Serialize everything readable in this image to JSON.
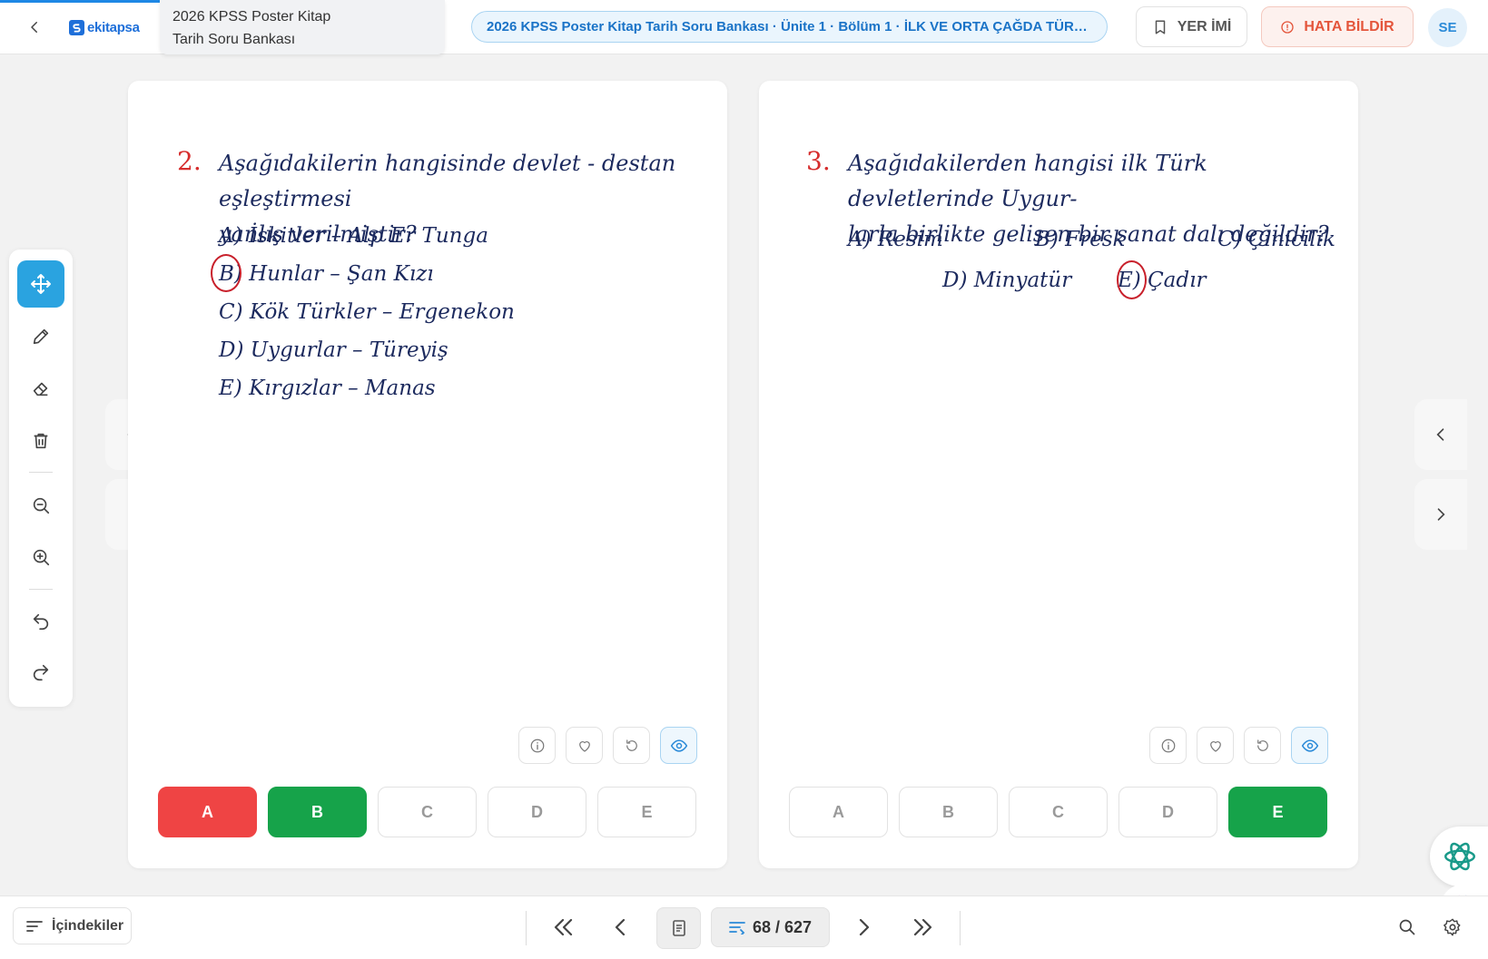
{
  "header": {
    "logo_text": "ekitapsa",
    "book_title_line1": "2026 KPSS Poster Kitap",
    "book_title_line2": "Tarih Soru Bankası",
    "breadcrumb": "2026 KPSS Poster Kitap Tarih Soru Bankası · Ünite 1 · Bölüm 1 · İLK VE ORTA ÇAĞDA TÜRK ...",
    "bookmark_label": "YER İMİ",
    "report_label": "HATA BİLDİR",
    "avatar_initials": "SE"
  },
  "toolbar": {
    "tools": [
      "move-icon",
      "pencil-icon",
      "eraser-icon",
      "trash-icon",
      "zoom-out-icon",
      "zoom-in-icon",
      "undo-icon",
      "redo-icon"
    ],
    "active_tool": "move-icon"
  },
  "left_page": {
    "question_number": "2.",
    "question_line1": "Aşağıdakilerin hangisinde devlet - destan eşleştirmesi",
    "question_line2": "yanlış verilmiştir?",
    "options": [
      "A) İskitler – Alp Er Tunga",
      "B) Hunlar – Şan Kızı",
      "C) Kök Türkler – Ergenekon",
      "D) Uygurlar – Türeyiş",
      "E) Kırgızlar – Manas"
    ],
    "circled_option": "B",
    "answer_buttons": [
      "A",
      "B",
      "C",
      "D",
      "E"
    ],
    "selected_wrong": "A",
    "correct_answer": "B"
  },
  "right_page": {
    "question_number": "3.",
    "question_line1": "Aşağıdakilerden hangisi ilk Türk devletlerinde Uygur-",
    "question_line2": "larla birlikte gelişen bir sanat dalı değildir?",
    "options": [
      "A) Resim",
      "B) Fresk",
      "C) Çinicilik",
      "D) Minyatür",
      "E) Çadır"
    ],
    "circled_option": "E",
    "answer_buttons": [
      "A",
      "B",
      "C",
      "D",
      "E"
    ],
    "correct_answer": "E"
  },
  "bottom": {
    "toc_label": "İçindekiler",
    "page_counter": "68 / 627"
  },
  "colors": {
    "accent": "#2aa3e0",
    "wrong": "#ef4444",
    "correct": "#16a34a",
    "question_number": "#d62d2d",
    "handwriting": "#1c2a5e"
  }
}
